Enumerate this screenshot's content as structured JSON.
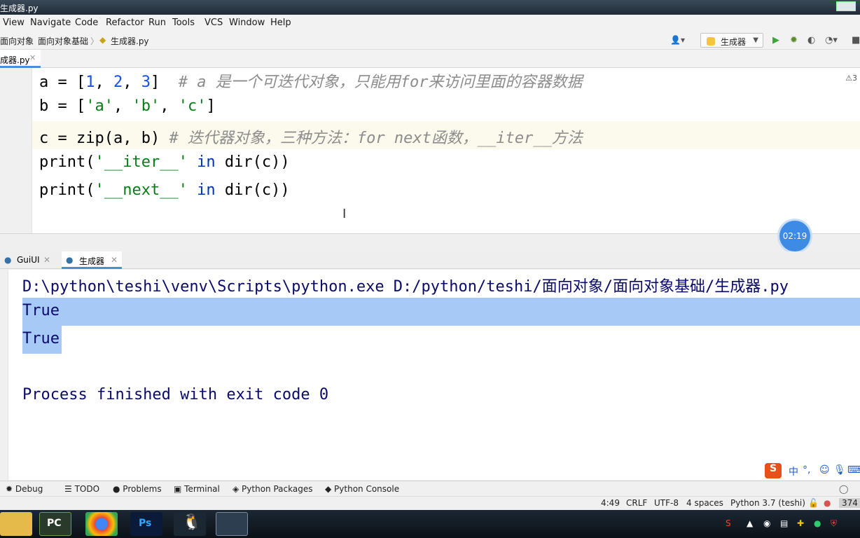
{
  "window": {
    "title": "生成器.py"
  },
  "menu": {
    "items": [
      "View",
      "Navigate",
      "Code",
      "Refactor",
      "Run",
      "Tools",
      "VCS",
      "Window",
      "Help"
    ]
  },
  "breadcrumb": [
    "面向对象",
    "面向对象基础",
    "生成器.py"
  ],
  "run_config": {
    "label": "生成器"
  },
  "editor_tab": {
    "label": "成器.py"
  },
  "editor": {
    "warning_count": "3",
    "lines": [
      {
        "p1": "a = [",
        "n1": "1",
        "s1": ", ",
        "n2": "2",
        "s2": ", ",
        "n3": "3",
        "s3": "]  ",
        "comment": "# a 是一个可迭代对象，只能用for来访问里面的容器数据"
      },
      {
        "p1": "b = [",
        "q1": "'a'",
        "s1": ", ",
        "q2": "'b'",
        "s2": ", ",
        "q3": "'c'",
        "s3": "]"
      },
      {
        "p1": "c = zip(a, b) ",
        "comment": "# 迭代器对象，三种方法：for next函数，__iter__方法"
      },
      {
        "p1": "print(",
        "q1": "'__iter__'",
        "kw": " in ",
        "p2": "dir(c))"
      },
      {
        "p1": "print(",
        "q1": "'__next__'",
        "kw": " in ",
        "p2": "dir(c))"
      }
    ]
  },
  "timer": "02:19",
  "run_tabs": [
    "GuiUI",
    "生成器"
  ],
  "console": {
    "command": "D:\\python\\teshi\\venv\\Scripts\\python.exe D:/python/teshi/面向对象/面向对象基础/生成器.py",
    "out1": "True",
    "out2": "True",
    "finish": "Process finished with exit code 0"
  },
  "ime": {
    "label": "中"
  },
  "tool_windows": [
    "Debug",
    "TODO",
    "Problems",
    "Terminal",
    "Python Packages",
    "Python Console"
  ],
  "status": {
    "position": "4:49",
    "line_sep": "CRLF",
    "encoding": "UTF-8",
    "indent": "4 spaces",
    "interpreter": "Python 3.7 (teshi)",
    "memory": "374"
  },
  "taskbar": {
    "apps": [
      "file-explorer",
      "pycharm",
      "chrome",
      "photoshop",
      "qq",
      "mysql"
    ]
  },
  "colors": {
    "accent": "#4a8ed8",
    "selection": "#a6c9f5",
    "comment": "#8c8c8c",
    "string": "#067d17",
    "number": "#1750eb"
  }
}
